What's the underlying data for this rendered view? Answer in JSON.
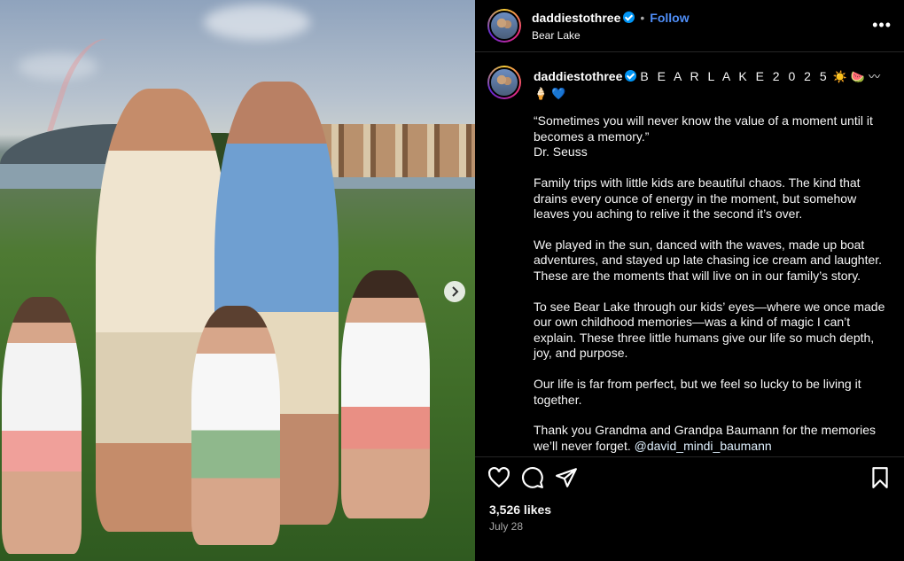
{
  "post": {
    "username": "daddiestothree",
    "follow_label": "Follow",
    "separator": "•",
    "location": "Bear Lake",
    "more_label": "•••"
  },
  "caption": {
    "title": "B E A R L A K E 2 0 2 5",
    "title_emoji": "☀️ 🍉 〰 🍦 💙",
    "paragraphs": [
      "“Sometimes you will never know the value of a moment until it becomes a memory.”\nDr. Seuss",
      "Family trips with little kids are beautiful chaos. The kind that drains every ounce of energy in the moment, but somehow leaves you aching to relive it the second it’s over.",
      "We played in the sun, danced with the waves, made up boat adventures, and stayed up late chasing ice cream and laughter. These are the moments that will live on in our family’s story.",
      "To see Bear Lake through our kids’ eyes—where we once made our own childhood memories—was a kind of magic I can’t explain. These three little humans give our life so much depth, joy, and purpose.",
      "Our life is far from perfect, but we feel so lucky to be living it together.",
      "Thank you Grandma and Grandpa Baumann for the memories we’ll never forget."
    ],
    "mention": "@david_mindi_baumann"
  },
  "engagement": {
    "likes": "3,526 likes",
    "date": "July 28"
  },
  "icons": {
    "like": "heart-icon",
    "comment": "comment-icon",
    "share": "send-icon",
    "save": "bookmark-icon",
    "next": "chevron-right-icon"
  },
  "colors": {
    "verified": "#0095f6",
    "follow": "#4f8ef7",
    "panel_bg": "#000000"
  }
}
